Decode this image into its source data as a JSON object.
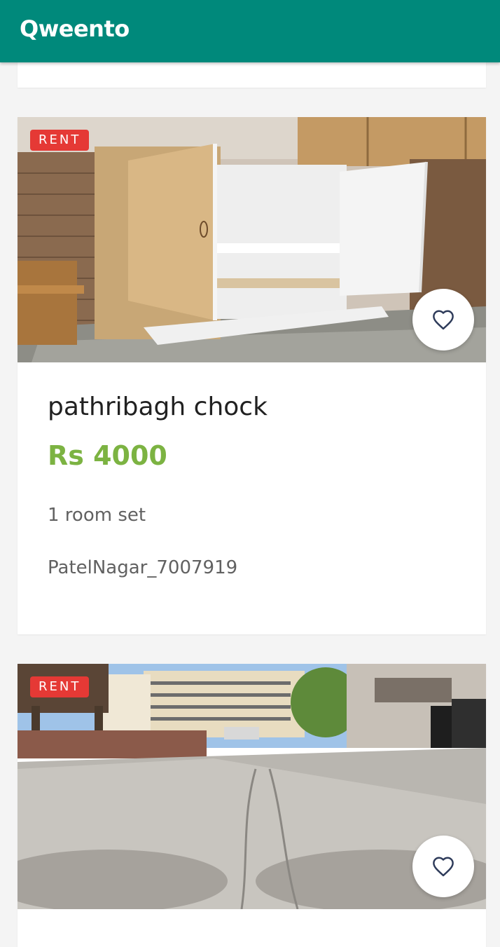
{
  "app": {
    "title": "Qweento"
  },
  "listings": [
    {
      "badge": "RENT",
      "image": "wooden cabinet with open white doors in a room",
      "title": "pathribagh chock",
      "price": "Rs 4000",
      "description": "1 room set",
      "code": "PatelNagar_7007919",
      "favorite_icon": "heart-outline-icon"
    },
    {
      "badge": "RENT",
      "image": "street view with buildings and unpaved road",
      "favorite_icon": "heart-outline-icon"
    }
  ],
  "colors": {
    "appbar": "#00897b",
    "badge": "#e53935",
    "price": "#7cb342",
    "heart": "#2e3b5a"
  }
}
